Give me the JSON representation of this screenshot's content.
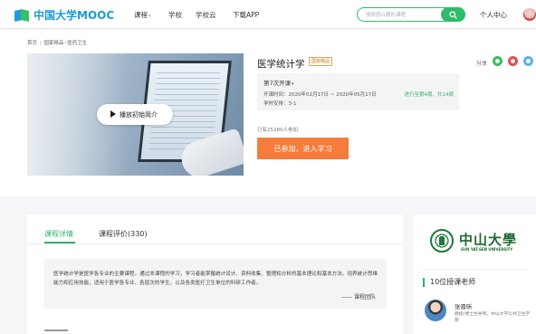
{
  "nav": {
    "logo_text": "中国大学MOOC",
    "links": [
      {
        "label": "课程",
        "caret": "▾"
      },
      {
        "label": "学校"
      },
      {
        "label": "学校云"
      },
      {
        "label": "下载APP"
      }
    ],
    "search_placeholder": "搜索感兴趣的课程",
    "user_center": "个人中心"
  },
  "breadcrumb": [
    "首页",
    "国家精品",
    "医药卫生"
  ],
  "course": {
    "title": "医学统计学",
    "badge": "国家精品",
    "share_label": "分享",
    "play_label": "播放初始简介",
    "term_select": "第7次开课",
    "term_dates": "开课时间：2020年02月17日 ~ 2020年05月17日",
    "term_hours": "学时安排：3-1",
    "term_progress": "进行至第4周，共14周",
    "enrolled": "已有25280人参加",
    "join_button": "已参加，进入学习"
  },
  "tabs": {
    "active": "课程详情",
    "inactive": "课程评价(330)"
  },
  "intro": {
    "text": "医学统计学是医学各专业的主要课程。通过本课程的学习，学习者能掌握统计设计、资料收集、整理和分析的基本理论和基本方法。培养统计思维能力和应用技能，适用于医学各专业、各层次的学生，以及各类医疗卫生单位的科研工作者。",
    "team": "—— 课程团队"
  },
  "side": {
    "uni_name": "中山大學",
    "uni_en": "SUN YAT-SEN UNIVERSITY",
    "teachers_head": "10位授课老师",
    "teacher_name": "张晋昕",
    "teacher_desc": "教授/博士生导师，中山大学公共卫生学院"
  },
  "colors": {
    "brand_green": "#2fb26a",
    "brand_blue": "#1b9bd6",
    "orange": "#f57c3a"
  }
}
